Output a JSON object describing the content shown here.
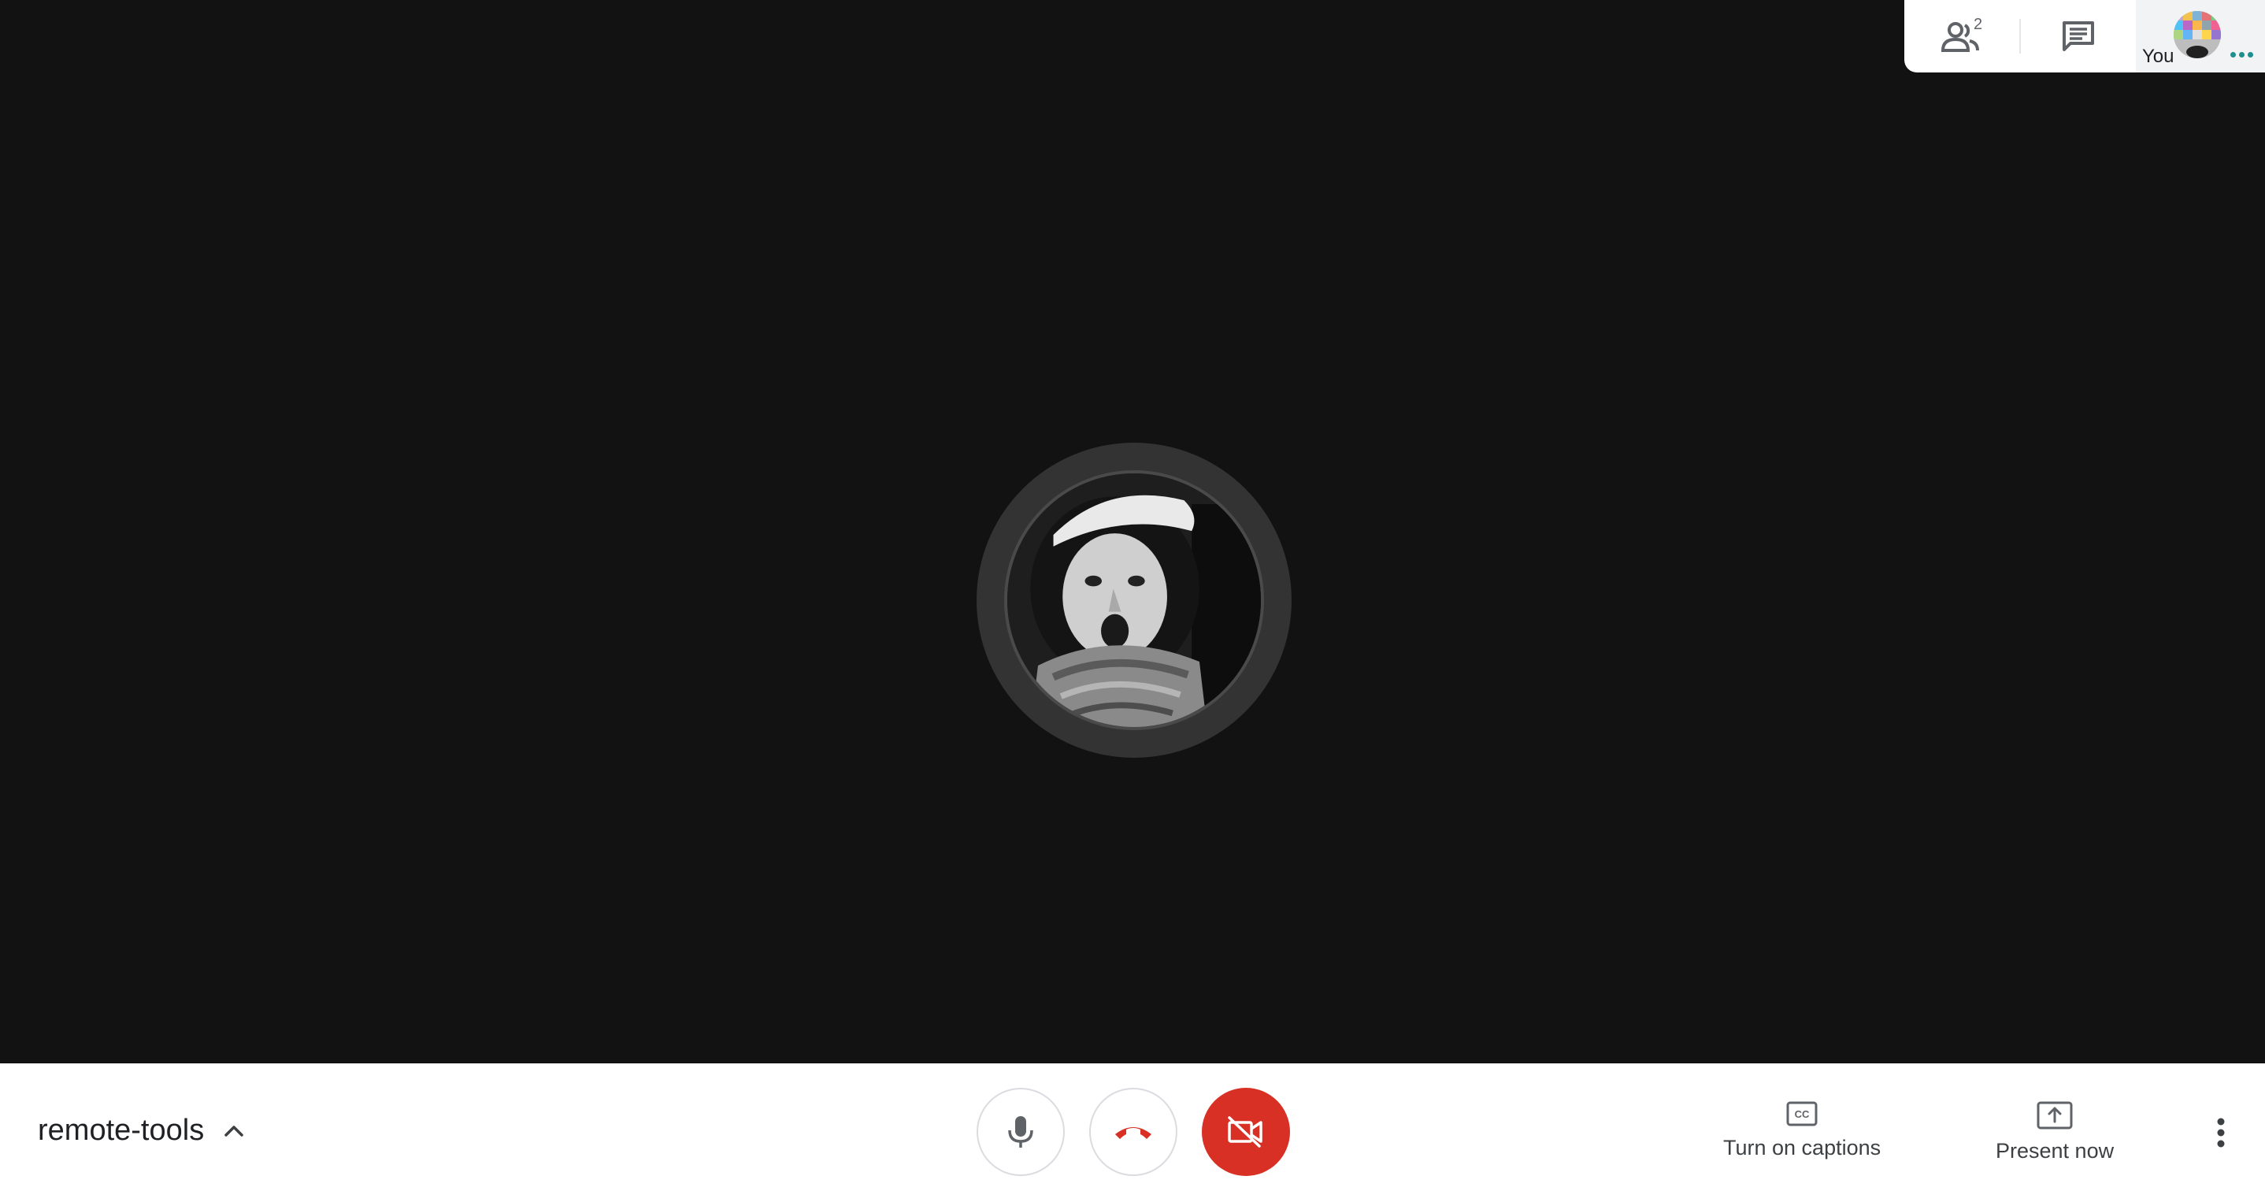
{
  "meeting": {
    "name": "remote-tools"
  },
  "top_panel": {
    "participant_count": "2",
    "self_label": "You"
  },
  "controls": {
    "mic_icon": "microphone-icon",
    "hangup_icon": "phone-hangup-icon",
    "camera_icon": "videocam-off-icon",
    "camera_state_color": "#d93025"
  },
  "actions": {
    "captions_label": "Turn on captions",
    "present_label": "Present now"
  },
  "icons": {
    "people": "people-icon",
    "chat": "chat-icon",
    "captions": "closed-captions-icon",
    "present": "present-screen-icon",
    "more": "more-vert-icon",
    "chevron": "chevron-up-icon"
  }
}
